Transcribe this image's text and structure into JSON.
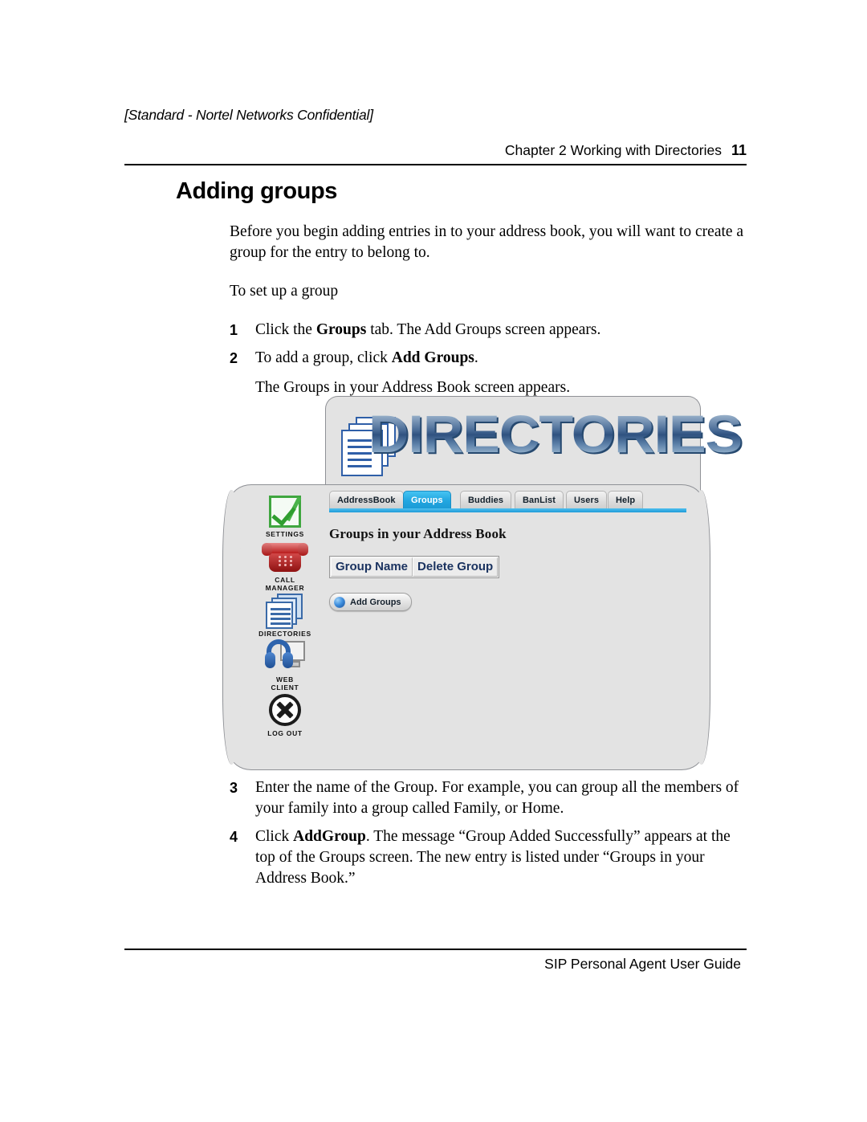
{
  "header": {
    "confidentiality": "[Standard - Nortel Networks Confidential]",
    "chapter": "Chapter 2  Working with Directories",
    "page_number": "11"
  },
  "section": {
    "title": "Adding groups",
    "intro": "Before you begin adding entries in to your address book, you will want to create a group for the entry to belong to.",
    "lead_in": "To set up a group",
    "steps": [
      {
        "number": "1",
        "text_before": "Click the ",
        "bold": "Groups",
        "text_after": " tab. The Add Groups screen appears."
      },
      {
        "number": "2",
        "text_before": "To add a group, click ",
        "bold": "Add Groups",
        "text_after": "."
      },
      {
        "number": "3",
        "text_before": "Enter the name of the Group. For example, you can group all the members of your family into a group called Family, or Home.",
        "bold": "",
        "text_after": ""
      },
      {
        "number": "4",
        "text_before": "Click ",
        "bold": "AddGroup",
        "text_after": ". The message “Group Added Successfully” appears at the top of the Groups screen. The new entry is listed under “Groups in your Address Book.”"
      }
    ],
    "substep_after_2": "The Groups in your Address Book screen appears."
  },
  "screenshot": {
    "banner_wordmark": "DIRECTORIES",
    "sidebar": [
      {
        "label": "SETTINGS",
        "icon": "green-check-box-icon"
      },
      {
        "label": "CALL\nMANAGER",
        "label_line1": "CALL",
        "label_line2": "MANAGER",
        "icon": "red-telephone-icon"
      },
      {
        "label": "DIRECTORIES",
        "icon": "stacked-documents-icon"
      },
      {
        "label": "WEB\nCLIENT",
        "label_line1": "WEB",
        "label_line2": "CLIENT",
        "icon": "headset-monitor-icon"
      },
      {
        "label": "LOG OUT",
        "icon": "x-circle-icon"
      }
    ],
    "tabs": [
      {
        "label": "AddressBook",
        "active": false
      },
      {
        "label": "Groups",
        "active": true
      },
      {
        "label": "Buddies",
        "active": false
      },
      {
        "label": "BanList",
        "active": false
      },
      {
        "label": "Users",
        "active": false
      },
      {
        "label": "Help",
        "active": false
      }
    ],
    "panel_heading": "Groups in your Address Book",
    "table_headers": [
      "Group Name",
      "Delete Group"
    ],
    "add_button_label": "Add Groups",
    "colors": {
      "panel_background": "#e3e3e3",
      "panel_border": "#8f9196",
      "active_tab": "#22a6e0",
      "tab_underline": "#1f9ad8",
      "table_header_text": "#1b3360",
      "wordmark_blue": "#2f5280"
    }
  },
  "footer": {
    "guide_title": "SIP Personal Agent User Guide"
  }
}
